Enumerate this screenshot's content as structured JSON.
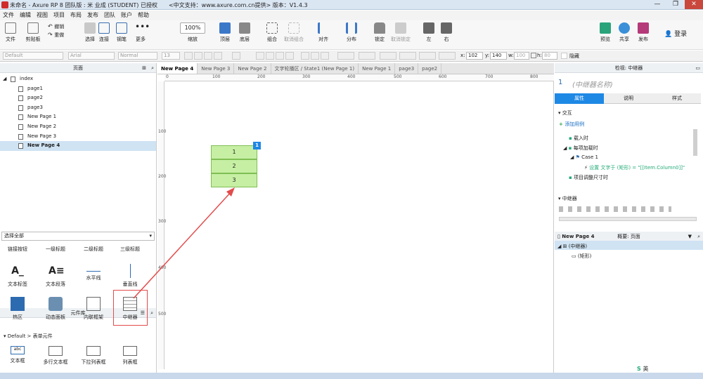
{
  "window": {
    "title": "未命名 - Axure RP 8 团队版 : 米 业成 (STUDENT) 已授权　　<中文支持：www.axure.com.cn提供> 版本：V1.4.3",
    "min": "—",
    "max": "❐",
    "close": "✕"
  },
  "menu": [
    "文件",
    "编辑",
    "视图",
    "项目",
    "布局",
    "发布",
    "团队",
    "账户",
    "帮助"
  ],
  "toolbar": {
    "file": "文件",
    "clipboard": "剪贴板",
    "undo": "撤销",
    "redo": "重做",
    "select": "选择",
    "connect": "连接",
    "pen": "钢笔",
    "more": "更多",
    "zoom_value": "100%",
    "zoom_label": "缩放",
    "top": "顶层",
    "bottom": "底层",
    "group": "组合",
    "ungroup": "取消组合",
    "align": "对齐",
    "distribute": "分布",
    "lock": "锁定",
    "unlock": "取消锁定",
    "left": "左",
    "right": "右",
    "preview": "预览",
    "share": "共享",
    "publish": "发布",
    "login": "登录"
  },
  "format": {
    "style": "Default",
    "font": "Arial",
    "weight": "Normal",
    "size": "13",
    "x_label": "x:",
    "x": "102",
    "y_label": "y:",
    "y": "140",
    "w_label": "w:",
    "w": "100",
    "h_label": "h:",
    "h": "80",
    "hidden": "隐藏"
  },
  "pages": {
    "header": "页面",
    "items": [
      "index",
      "page1",
      "page2",
      "page3",
      "New Page 1",
      "New Page 2",
      "New Page 3",
      "New Page 4"
    ],
    "selected": "New Page 4"
  },
  "library": {
    "header": "元件库",
    "select": "选择全部",
    "row1": [
      "链接按钮",
      "一级标题",
      "二级标题",
      "三级标题"
    ],
    "row2": [
      "文本标签",
      "文本段落",
      "水平线",
      "垂直线"
    ],
    "row3": [
      "热区",
      "动态面板",
      "内联框架",
      "中继器"
    ],
    "group2": "Default > 表单元件",
    "row4": [
      "文本框",
      "多行文本框",
      "下拉列表框",
      "列表框"
    ]
  },
  "tabs": [
    "New Page 4",
    "New Page 3",
    "New Page 2",
    "文字轮播区 / State1 (New Page 1)",
    "New Page 1",
    "page3",
    "page2"
  ],
  "ruler": {
    "h": [
      "0",
      "100",
      "200",
      "300",
      "400",
      "500",
      "600",
      "700",
      "800"
    ],
    "v": [
      "100",
      "200",
      "300",
      "400",
      "500"
    ]
  },
  "repeater": {
    "rows": [
      "1",
      "2",
      "3"
    ],
    "badge": "1"
  },
  "inspector": {
    "header": "检视: 中继器",
    "number": "1",
    "name_placeholder": "(中继器名称)",
    "tabs": [
      "属性",
      "说明",
      "样式"
    ],
    "interaction": "交互",
    "add_case": "添加用例",
    "events": [
      "载入时",
      "每项加载时",
      "Case 1",
      "设置 文字于 (矩形) = \"[[Item.Column0]]\"",
      "项目调整尺寸时"
    ],
    "repeater_section": "中继器"
  },
  "outline": {
    "header": "概要: 页面",
    "page": "New Page 4",
    "items": [
      "(中继器)",
      "(矩形)"
    ]
  },
  "tray": {
    "ime": "英"
  }
}
